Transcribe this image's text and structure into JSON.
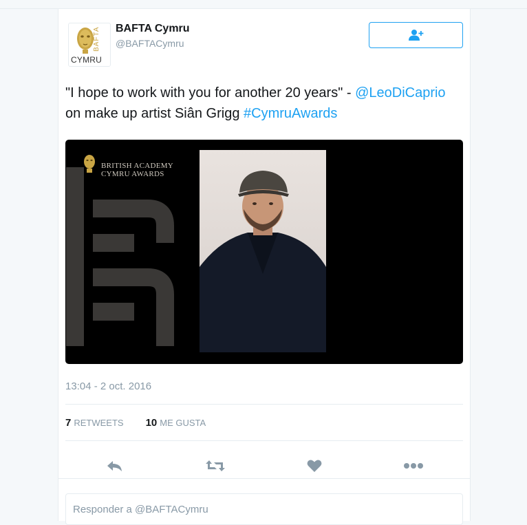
{
  "colors": {
    "brand_blue": "#1da1f2",
    "muted": "#8899a6",
    "heart": "#8899a6"
  },
  "author": {
    "name": "BAFTA Cymru",
    "handle": "@BAFTACymru",
    "avatar_text_bafta": "BAFTA",
    "avatar_text_cymru": "CYMRU",
    "follow_icon": "follow-user-plus-icon"
  },
  "tweet": {
    "text_part1": "\"I hope to work with you for another 20 years\" - ",
    "mention": "@LeoDiCaprio",
    "text_part2": "on make up artist Siân Grigg ",
    "hashtag": "#CymruAwards"
  },
  "media": {
    "brand_line1": "BRITISH ACADEMY",
    "brand_line2": "CYMRU AWARDS"
  },
  "timestamp": "13:04 - 2 oct. 2016",
  "stats": {
    "retweets_count": "7",
    "retweets_label": "RETWEETS",
    "likes_count": "10",
    "likes_label": "ME GUSTA"
  },
  "actions": {
    "reply_icon": "reply-icon",
    "retweet_icon": "retweet-icon",
    "like_icon": "heart-icon",
    "more_icon": "more-dots-icon"
  },
  "reply": {
    "placeholder": "Responder a @BAFTACymru"
  }
}
